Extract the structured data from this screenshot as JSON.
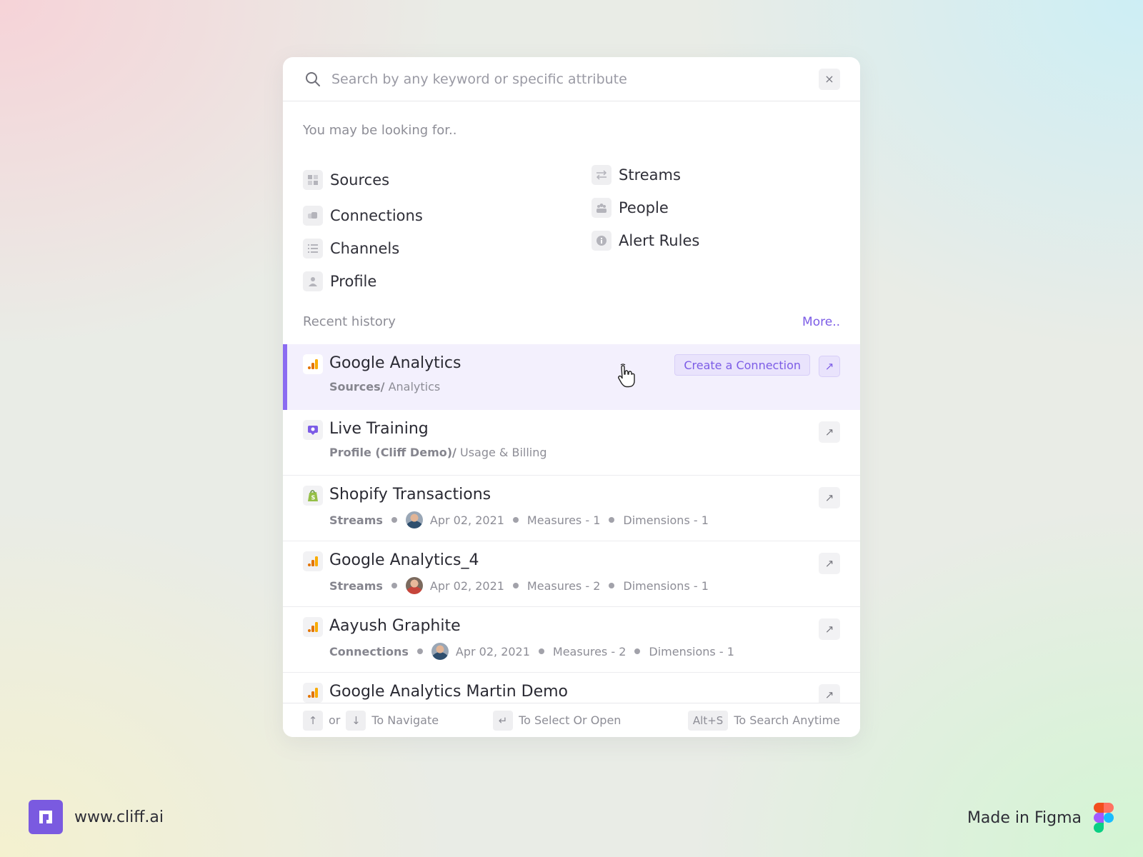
{
  "search": {
    "placeholder": "Search by any keyword or specific attribute",
    "close_label": "×"
  },
  "suggestions": {
    "heading": "You may be looking for..",
    "left": [
      {
        "label": "Sources",
        "icon": "grid-icon"
      },
      {
        "label": "Connections",
        "icon": "connection-icon"
      },
      {
        "label": "Channels",
        "icon": "list-icon"
      },
      {
        "label": "Profile",
        "icon": "person-icon"
      }
    ],
    "right": [
      {
        "label": "Streams",
        "icon": "swap-arrows-icon"
      },
      {
        "label": "People",
        "icon": "people-icon"
      },
      {
        "label": "Alert Rules",
        "icon": "info-icon"
      }
    ]
  },
  "recent": {
    "heading": "Recent history",
    "more_label": "More..",
    "create_connection_label": "Create a Connection",
    "items": [
      {
        "title": "Google Analytics",
        "path_bold": "Sources/",
        "path_rest": " Analytics",
        "icon": "google-analytics-icon",
        "active": true
      },
      {
        "title": "Live Training",
        "path_bold": "Profile (Cliff Demo)/",
        "path_rest": " Usage & Billing",
        "icon": "live-training-icon"
      },
      {
        "title": "Shopify Transactions",
        "type": "Streams",
        "date": "Apr 02, 2021",
        "measures": "Measures - 1",
        "dimensions": "Dimensions - 1",
        "icon": "shopify-icon"
      },
      {
        "title": "Google Analytics_4",
        "type": "Streams",
        "date": "Apr 02, 2021",
        "measures": "Measures - 2",
        "dimensions": "Dimensions - 1",
        "icon": "google-analytics-icon"
      },
      {
        "title": "Aayush Graphite",
        "type": "Connections",
        "date": "Apr 02, 2021",
        "measures": "Measures - 2",
        "dimensions": "Dimensions - 1",
        "icon": "google-analytics-icon"
      },
      {
        "title": "Google Analytics Martin Demo",
        "icon": "google-analytics-icon"
      }
    ]
  },
  "footer": {
    "up_key": "↑",
    "or": "or",
    "down_key": "↓",
    "navigate": "To Navigate",
    "enter_key": "↵",
    "select": "To Select Or Open",
    "shortcut_key": "Alt+S",
    "search_anytime": "To Search Anytime"
  },
  "brand": {
    "url": "www.cliff.ai",
    "made_in": "Made in Figma"
  },
  "colors": {
    "accent": "#7c5ce6",
    "active_row": "#f3f0fd",
    "ga_orange": "#f9ab00",
    "shopify_green": "#95bf47"
  }
}
